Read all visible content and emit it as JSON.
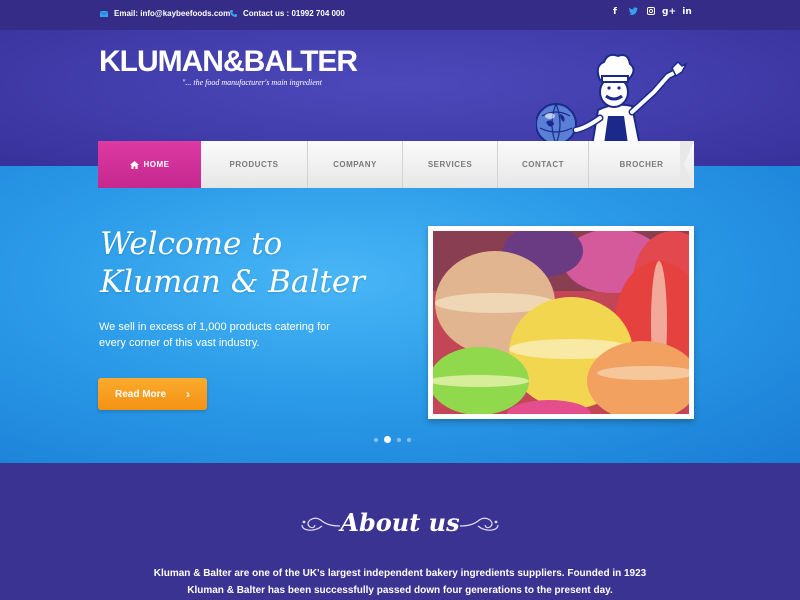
{
  "topbar": {
    "email": "Email: info@kaybeefoods.com",
    "contact": "Contact us : 01992 704 000",
    "socials": [
      "f",
      "t",
      "ig",
      "g+",
      "in"
    ]
  },
  "brand": {
    "logo": "KLUMAN&BALTER",
    "tagline": "\"... the food manufacturer's main ingredient"
  },
  "nav": {
    "items": [
      {
        "label": "HOME",
        "active": true
      },
      {
        "label": "PRODUCTS"
      },
      {
        "label": "COMPANY"
      },
      {
        "label": "SERVICES"
      },
      {
        "label": "CONTACT"
      },
      {
        "label": "BROCHER"
      }
    ]
  },
  "hero": {
    "title_line1": "Welcome to",
    "title_line2": "Kluman & Balter",
    "lead": "We sell in excess of 1,000 products catering for every corner of this vast industry.",
    "button": "Read More",
    "slides": 4,
    "active_slide": 2
  },
  "about": {
    "title": "About us",
    "text": "Kluman & Balter are one of the UK's largest independent bakery ingredients suppliers. Founded in 1923 Kluman & Balter has been successfully passed down four generations to the present day."
  },
  "colors": {
    "nav_active": "#d6339b",
    "button": "#f7981b",
    "hero": "#2b9be8",
    "header": "#433fae"
  }
}
